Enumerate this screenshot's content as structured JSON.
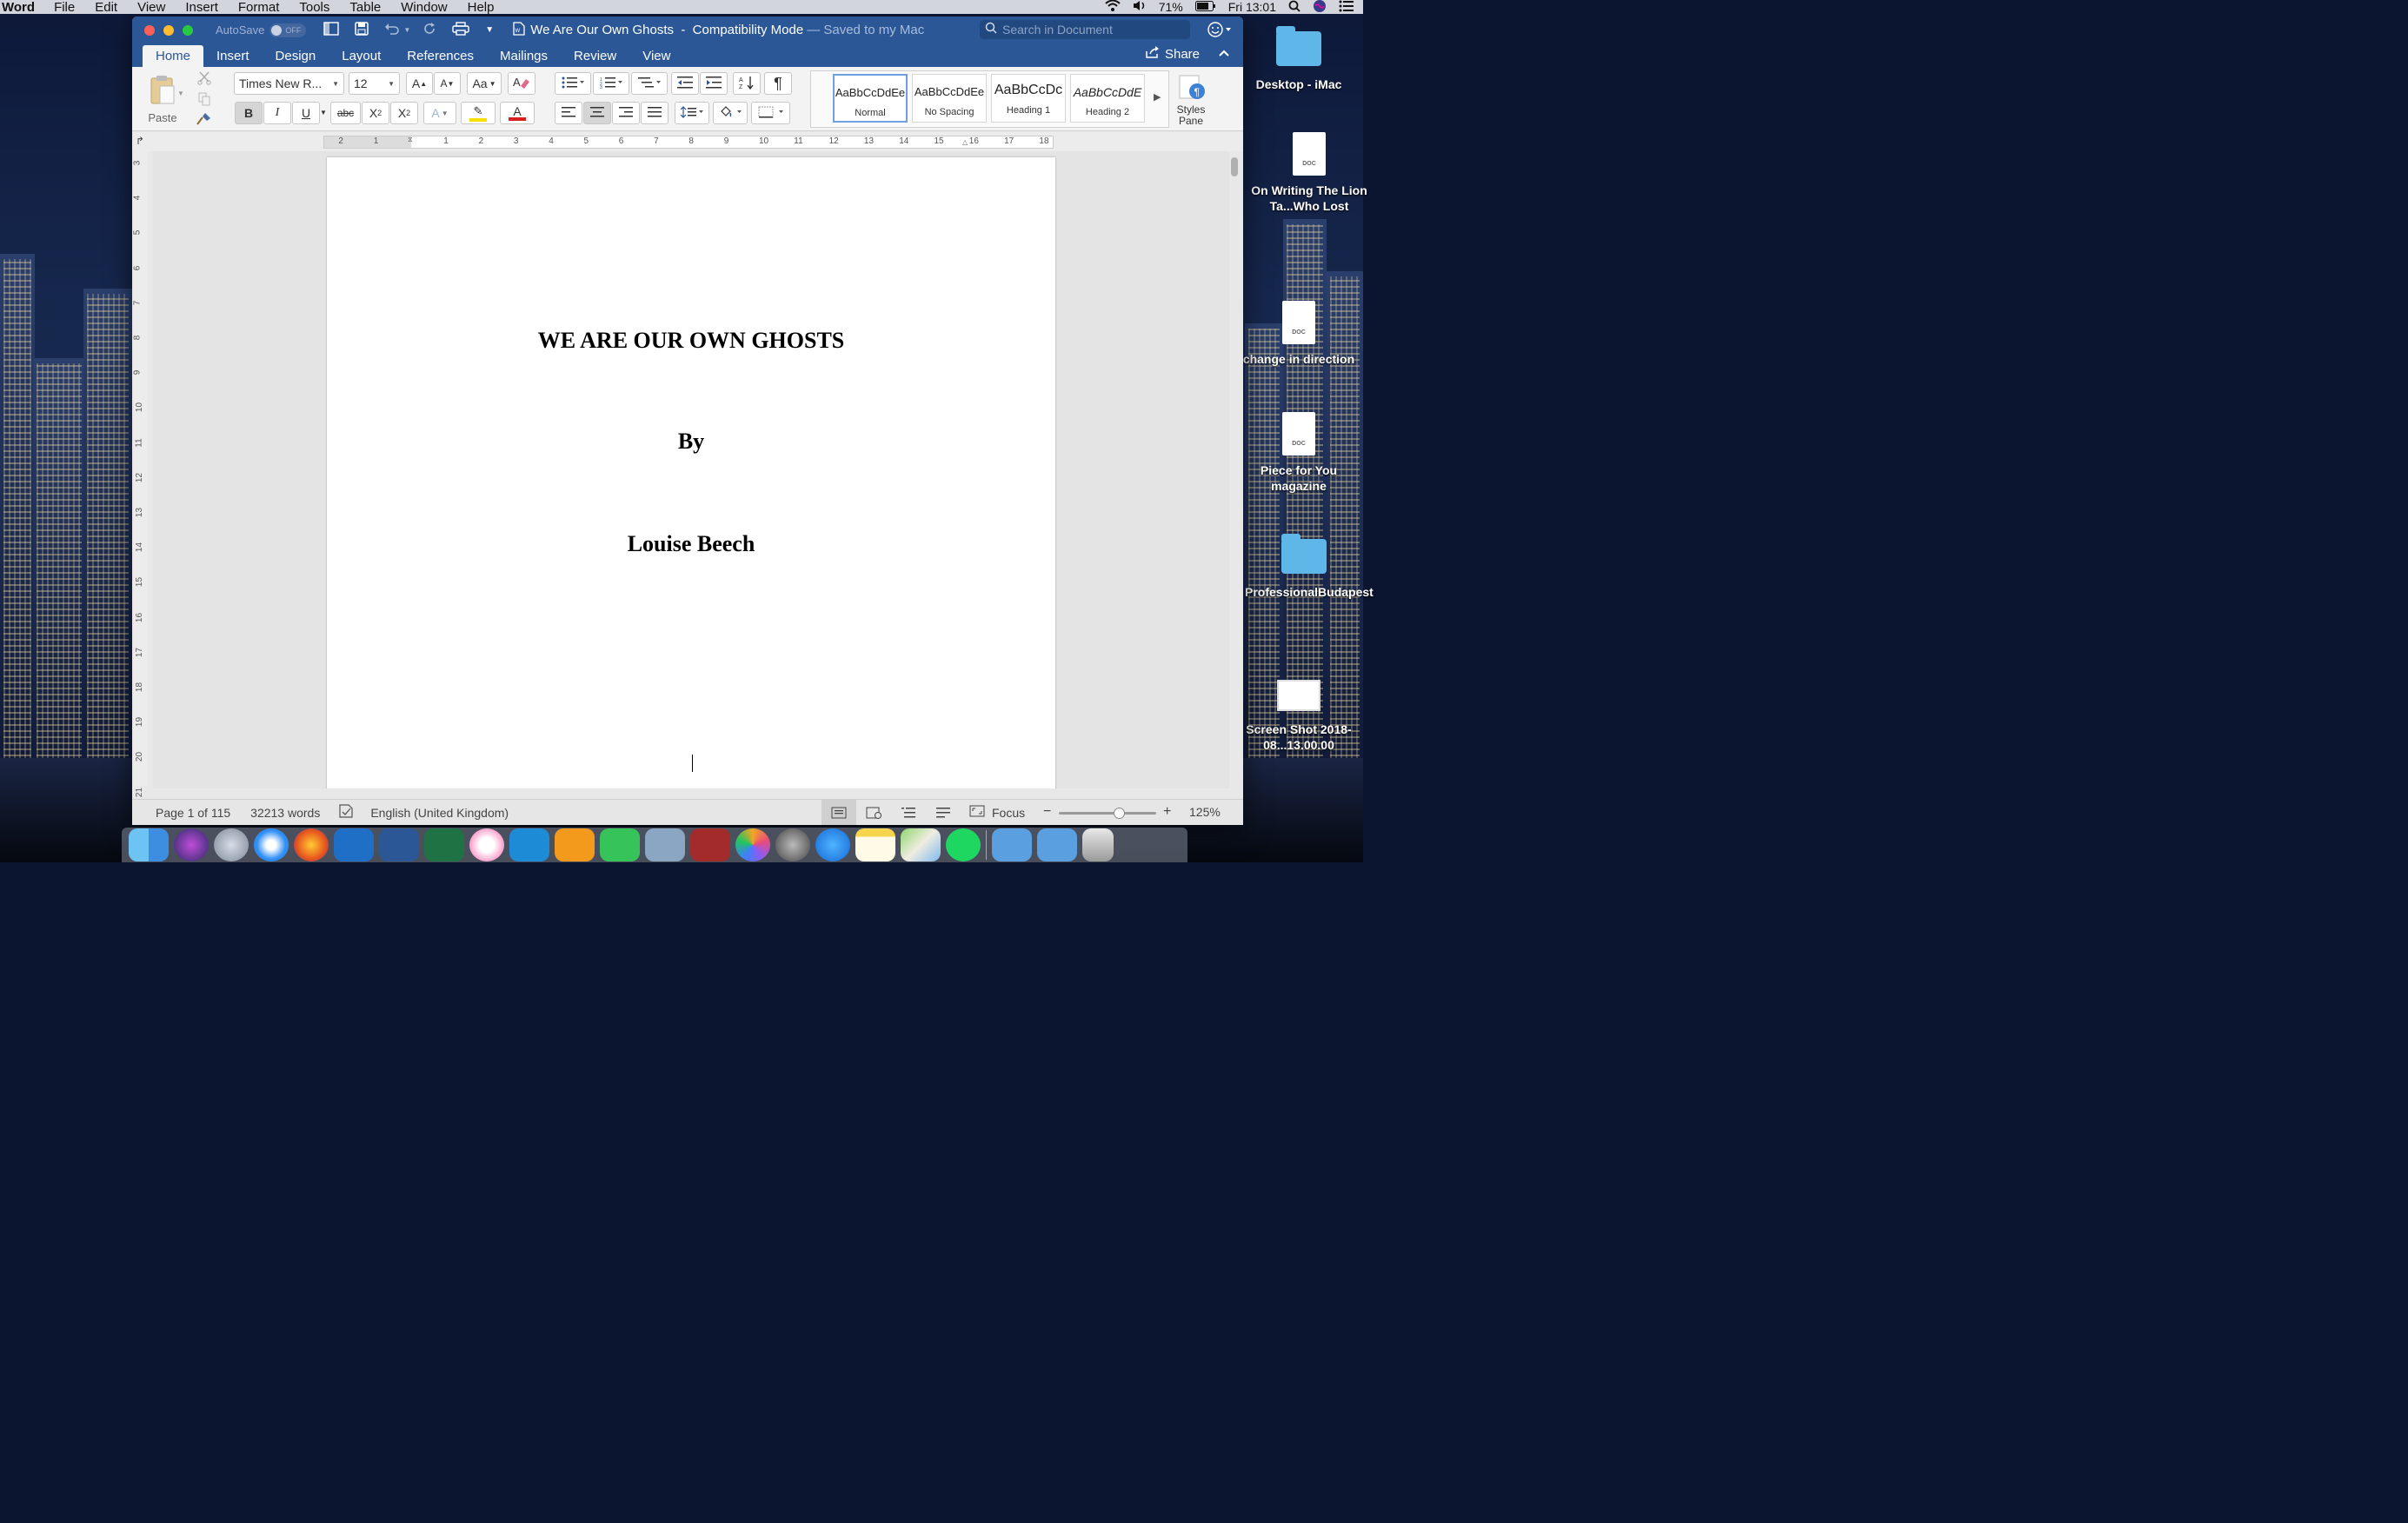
{
  "menubar": {
    "app": "Word",
    "items": [
      "File",
      "Edit",
      "View",
      "Insert",
      "Format",
      "Tools",
      "Table",
      "Window",
      "Help"
    ],
    "battery": "71%",
    "clock": "Fri 13:01"
  },
  "window": {
    "autosave_label": "AutoSave",
    "autosave_state": "OFF",
    "title": "We Are Our Own Ghosts  -  Compatibility Mode",
    "title_suffix": "— Saved to my Mac",
    "search_placeholder": "Search in Document"
  },
  "tabs": [
    "Home",
    "Insert",
    "Design",
    "Layout",
    "References",
    "Mailings",
    "Review",
    "View"
  ],
  "share_label": "Share",
  "ribbon": {
    "paste_label": "Paste",
    "font_name": "Times New R...",
    "font_size": "12",
    "styles": [
      {
        "sample": "AaBbCcDdEe",
        "name": "Normal"
      },
      {
        "sample": "AaBbCcDdEe",
        "name": "No Spacing"
      },
      {
        "sample": "AaBbCcDc",
        "name": "Heading 1"
      },
      {
        "sample": "AaBbCcDdE",
        "name": "Heading 2"
      }
    ],
    "styles_pane_label": "Styles Pane"
  },
  "ruler_numbers": [
    "2",
    "1",
    "1",
    "2",
    "3",
    "4",
    "5",
    "6",
    "7",
    "8",
    "9",
    "10",
    "11",
    "12",
    "13",
    "14",
    "15",
    "16",
    "17",
    "18"
  ],
  "vruler_numbers": [
    "3",
    "4",
    "5",
    "6",
    "7",
    "8",
    "9",
    "10",
    "11",
    "12",
    "13",
    "14",
    "15",
    "16",
    "17",
    "18",
    "19",
    "20",
    "21"
  ],
  "document": {
    "title": "WE ARE OUR OWN GHOSTS",
    "by": "By",
    "author": "Louise Beech"
  },
  "statusbar": {
    "page": "Page 1 of 115",
    "words": "32213 words",
    "language": "English (United Kingdom)",
    "focus": "Focus",
    "zoom": "125%",
    "zoom_level": 0.62
  },
  "desktop_icons": [
    {
      "label": "Desktop - iMac",
      "kind": "folder"
    },
    {
      "label": "On Writing The Lion Ta...Who Lost",
      "kind": "doc"
    },
    {
      "label": "change in direction",
      "kind": "doc"
    },
    {
      "label": "Piece for You magazine",
      "kind": "doc"
    },
    {
      "label": "ProfessionalBudapest",
      "kind": "folder"
    },
    {
      "label": "Screen Shot 2018-08...13.00.00",
      "kind": "image"
    }
  ],
  "dock_apps": [
    "Finder",
    "Siri",
    "Launchpad",
    "Safari",
    "Firefox",
    "Outlook",
    "Word",
    "Excel",
    "iTunes",
    "Kindle",
    "iBooks",
    "FaceTime",
    "Preview",
    "Photo Booth",
    "Photos",
    "System Preferences",
    "App Store",
    "Notes",
    "Maps",
    "Spotify",
    "Applications",
    "Downloads",
    "Trash"
  ],
  "colors": {
    "word_blue": "#2b5797",
    "ribbon_bg": "#f3f3f3",
    "font_color_red": "#d81e1e",
    "highlight_yellow": "#f5e000"
  }
}
